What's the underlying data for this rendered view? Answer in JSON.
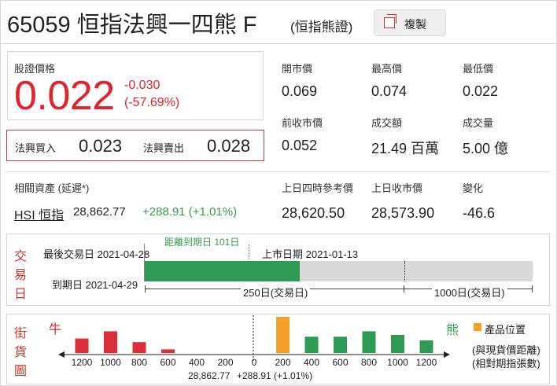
{
  "header": {
    "title": "65059 恒指法興一四熊 F",
    "subtitle": "(恒指熊證)",
    "copy_label": "複製"
  },
  "price": {
    "label": "股證價格",
    "value": "0.022",
    "change": "-0.030",
    "change_pct": "(-57.69%)"
  },
  "quote": {
    "bid_label": "法興買入",
    "bid": "0.023",
    "ask_label": "法興賣出",
    "ask": "0.028"
  },
  "stats": [
    {
      "label": "開市價",
      "value": "0.069"
    },
    {
      "label": "最高價",
      "value": "0.074"
    },
    {
      "label": "最低價",
      "value": "0.022"
    },
    {
      "label": "前收市價",
      "value": "0.052"
    },
    {
      "label": "成交額",
      "value": "21.49 百萬"
    },
    {
      "label": "成交量",
      "value": "5.00 億"
    }
  ],
  "underlying": {
    "label": "相關資產 (延遲*)",
    "link": "HSI 恒指",
    "price": "28,862.77",
    "change": "+288.91 (+1.01%)",
    "ref_label": "上日四時參考價",
    "ref_value": "28,620.50",
    "close_label": "上日收市價",
    "close_value": "28,573.90",
    "chg_label": "變化",
    "chg_value": "-46.6"
  },
  "trading_days": {
    "side_title": [
      "交",
      "易",
      "日"
    ],
    "last_trade": "最後交易日 2021-04-28",
    "to_expiry": "距離到期日 101日",
    "listing": "上市日期 2021-01-13",
    "expiry": "到期日 2021-04-29",
    "label_250": "250日(交易日)",
    "label_1000": "1000日(交易日)",
    "elapsed_days": 149,
    "remaining_days": 101,
    "colors": {
      "elapsed": "#2e9a55",
      "remaining": "#d9d9d9"
    }
  },
  "street": {
    "side_title": [
      "街",
      "貨",
      "圖"
    ],
    "bull_label": "牛",
    "bear_label": "熊",
    "legend_label": "產品位置",
    "note1": "(與現貨價距離)",
    "note2": "(相對期指張數)",
    "axis_ticks": [
      "1200",
      "1000",
      "800",
      "600",
      "400",
      "200",
      "0",
      "200",
      "400",
      "600",
      "800",
      "1000",
      "1200"
    ],
    "spot_price": "28,862.77",
    "spot_change": "+288.91 (+1.01%)",
    "colors": {
      "bull": "#dc2e3a",
      "bear": "#2e9a55",
      "product": "#f5a02a"
    }
  },
  "chart_data": {
    "type": "bar",
    "categories": [
      "1200",
      "1000",
      "800",
      "600",
      "400",
      "200",
      "0",
      "200",
      "400",
      "600",
      "800",
      "1000",
      "1200"
    ],
    "series": [
      {
        "values": [
          0.4,
          0.6,
          0.3,
          0.1,
          0,
          0,
          0,
          0,
          0,
          0,
          0,
          0,
          0
        ]
      },
      {
        "values": [
          0,
          0,
          0,
          0,
          0,
          0,
          0,
          1.0,
          0,
          0,
          0,
          0,
          0
        ]
      },
      {
        "values": [
          0,
          0,
          0,
          0,
          0,
          0,
          0,
          0,
          0.45,
          0.45,
          0.6,
          0.5,
          0.35
        ]
      }
    ],
    "xlabel": "",
    "ylabel": ""
  }
}
